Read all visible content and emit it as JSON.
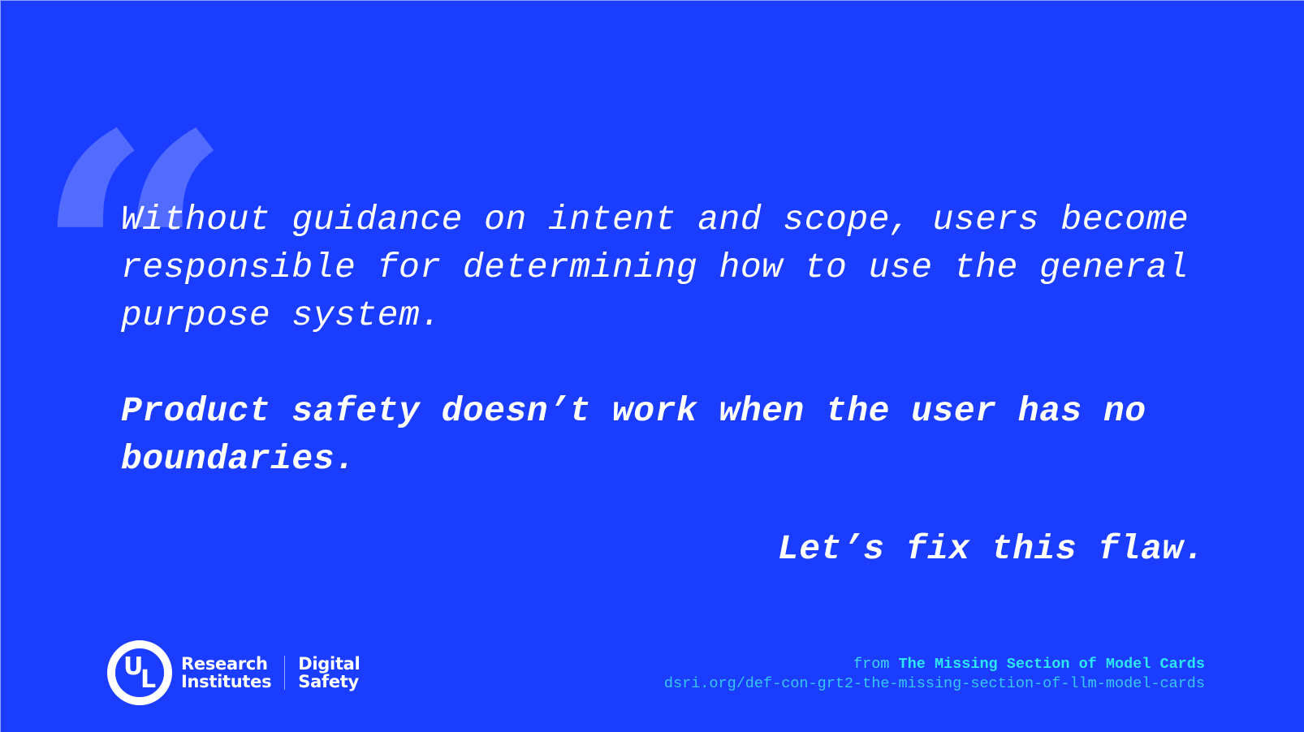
{
  "theme": {
    "background": "#1a3dff",
    "quote_mark_color": "#5c75ff",
    "text_color": "#ffffff",
    "citation_title_color": "#2ee6f5",
    "citation_url_color": "#38c8ef"
  },
  "quote": {
    "mark_glyph": "“",
    "body": "Without guidance on intent and scope, users become responsible for determining how to use the general purpose system.",
    "emphasis": "Product safety doesn’t work when the user has no boundaries.",
    "call_to_action": "Let’s fix this flaw."
  },
  "logo": {
    "mark_u": "U",
    "mark_l": "L",
    "org_line1": "Research",
    "org_line2": "Institutes",
    "division_line1": "Digital",
    "division_line2": "Safety"
  },
  "citation": {
    "prefix": "from",
    "title": "The Missing Section of Model Cards",
    "url": "dsri.org/def-con-grt2-the-missing-section-of-llm-model-cards"
  }
}
